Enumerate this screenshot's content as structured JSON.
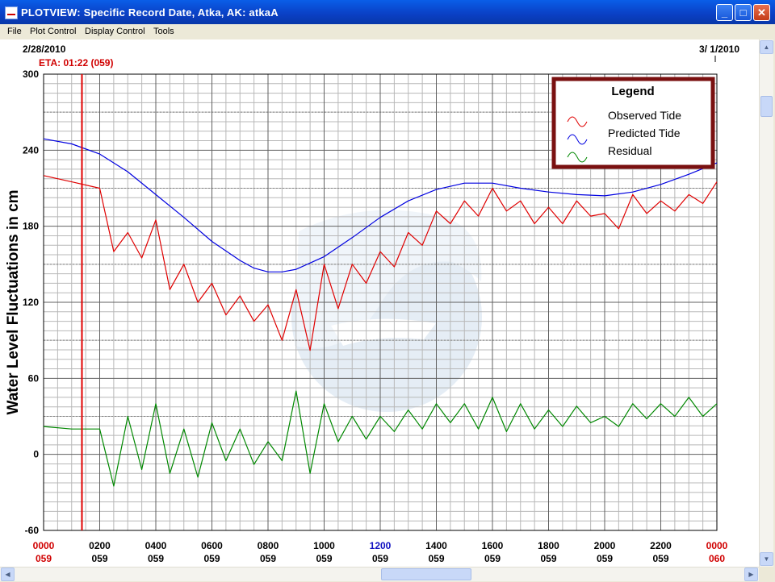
{
  "window": {
    "title": "PLOTVIEW: Specific Record Date, Atka, AK: atkaA",
    "minimize_icon": "minimize-icon",
    "maximize_icon": "maximize-icon",
    "close_icon": "close-icon"
  },
  "menu": [
    "File",
    "Plot Control",
    "Display Control",
    "Tools"
  ],
  "plot": {
    "date_left": "2/28/2010",
    "date_right": "3/ 1/2010",
    "eta_label": "ETA: 01:22 (059)",
    "eta_hours": 1.3667,
    "ylabel": "Water Level Fluctuations in cm",
    "y_ticks": [
      "300",
      "240",
      "180",
      "120",
      "60",
      "0",
      "-60"
    ],
    "x_ticks": [
      {
        "time": "0000",
        "day": "059",
        "color": "#d00000"
      },
      {
        "time": "0200",
        "day": "059",
        "color": "#000000"
      },
      {
        "time": "0400",
        "day": "059",
        "color": "#000000"
      },
      {
        "time": "0600",
        "day": "059",
        "color": "#000000"
      },
      {
        "time": "0800",
        "day": "059",
        "color": "#000000"
      },
      {
        "time": "1000",
        "day": "059",
        "color": "#000000"
      },
      {
        "time": "1200",
        "day": "059",
        "color": "#1010c0"
      },
      {
        "time": "1400",
        "day": "059",
        "color": "#000000"
      },
      {
        "time": "1600",
        "day": "059",
        "color": "#000000"
      },
      {
        "time": "1800",
        "day": "059",
        "color": "#000000"
      },
      {
        "time": "2000",
        "day": "059",
        "color": "#000000"
      },
      {
        "time": "2200",
        "day": "059",
        "color": "#000000"
      },
      {
        "time": "0000",
        "day": "060",
        "color": "#d00000"
      }
    ],
    "watermark_icon": "noaa-logo-icon"
  },
  "legend": {
    "title": "Legend",
    "items": [
      {
        "label": "Observed Tide",
        "color": "#e00000"
      },
      {
        "label": "Predicted Tide",
        "color": "#0000e0"
      },
      {
        "label": "Residual",
        "color": "#008800"
      }
    ]
  },
  "chart_data": {
    "type": "line",
    "xlabel": "",
    "ylabel": "Water Level Fluctuations in cm",
    "x_unit": "hours from 0000 day 059",
    "xlim": [
      0,
      24
    ],
    "ylim": [
      -60,
      300
    ],
    "grid": true,
    "legend_position": "top-right",
    "series": [
      {
        "name": "Predicted Tide",
        "color": "#0000e0",
        "x": [
          0,
          1,
          2,
          3,
          4,
          5,
          6,
          7,
          7.5,
          8,
          8.5,
          9,
          10,
          11,
          12,
          13,
          14,
          15,
          16,
          17,
          18,
          19,
          20,
          21,
          22,
          23,
          24
        ],
        "y": [
          249,
          245,
          237,
          223,
          205,
          187,
          168,
          153,
          147,
          144,
          144,
          146,
          156,
          171,
          187,
          200,
          209,
          214,
          214,
          210,
          207,
          205,
          204,
          207,
          213,
          221,
          230
        ]
      },
      {
        "name": "Observed Tide",
        "color": "#e00000",
        "x": [
          0,
          1,
          2,
          2.5,
          3,
          3.5,
          4,
          4.5,
          5,
          5.5,
          6,
          6.5,
          7,
          7.5,
          8,
          8.5,
          9,
          9.5,
          10,
          10.5,
          11,
          11.5,
          12,
          12.5,
          13,
          13.5,
          14,
          14.5,
          15,
          15.5,
          16,
          16.5,
          17,
          17.5,
          18,
          18.5,
          19,
          19.5,
          20,
          20.5,
          21,
          21.5,
          22,
          22.5,
          23,
          23.5,
          24
        ],
        "y": [
          220,
          215,
          210,
          160,
          175,
          155,
          185,
          130,
          150,
          120,
          135,
          110,
          125,
          105,
          118,
          90,
          130,
          82,
          150,
          115,
          150,
          135,
          160,
          148,
          175,
          165,
          192,
          182,
          200,
          188,
          210,
          192,
          200,
          182,
          195,
          182,
          200,
          188,
          190,
          178,
          205,
          190,
          200,
          192,
          205,
          198,
          215
        ]
      },
      {
        "name": "Residual",
        "color": "#008800",
        "x": [
          0,
          1,
          2,
          2.5,
          3,
          3.5,
          4,
          4.5,
          5,
          5.5,
          6,
          6.5,
          7,
          7.5,
          8,
          8.5,
          9,
          9.5,
          10,
          10.5,
          11,
          11.5,
          12,
          12.5,
          13,
          13.5,
          14,
          14.5,
          15,
          15.5,
          16,
          16.5,
          17,
          17.5,
          18,
          18.5,
          19,
          19.5,
          20,
          20.5,
          21,
          21.5,
          22,
          22.5,
          23,
          23.5,
          24
        ],
        "y": [
          22,
          20,
          20,
          -25,
          30,
          -12,
          40,
          -15,
          20,
          -18,
          25,
          -5,
          20,
          -8,
          10,
          -5,
          50,
          -15,
          40,
          10,
          30,
          12,
          30,
          18,
          35,
          20,
          40,
          25,
          40,
          20,
          45,
          18,
          40,
          20,
          35,
          22,
          38,
          25,
          30,
          22,
          40,
          28,
          40,
          30,
          45,
          30,
          40
        ]
      }
    ]
  }
}
